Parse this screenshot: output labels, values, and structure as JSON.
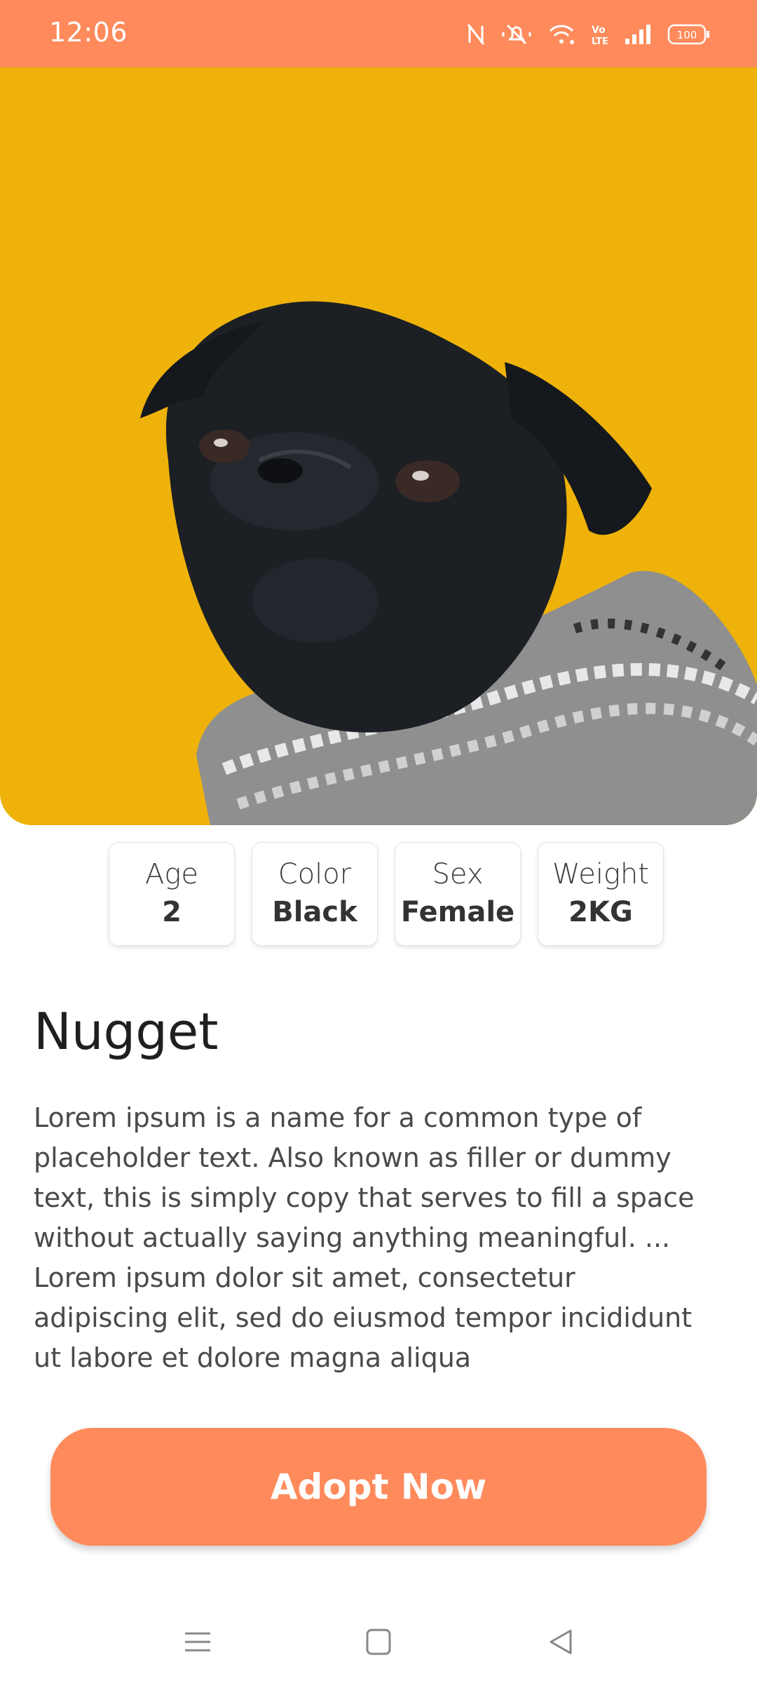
{
  "status_bar": {
    "time": "12:06",
    "battery": "100",
    "icons": [
      "nfc-icon",
      "mute-icon",
      "wifi-icon",
      "volte-icon",
      "signal-icon",
      "battery-icon"
    ]
  },
  "hero": {
    "image": "black-pug-in-sweater-photo",
    "background": "#EEB20A"
  },
  "stats": [
    {
      "label": "Age",
      "value": "2"
    },
    {
      "label": "Color",
      "value": "Black"
    },
    {
      "label": "Sex",
      "value": "Female"
    },
    {
      "label": "Weight",
      "value": "2KG"
    }
  ],
  "pet": {
    "name": "Nugget",
    "description": "Lorem ipsum is a name for a common type of placeholder text. Also known as filler or dummy text, this is simply copy that serves to fill a space without actually saying anything meaningful. ... Lorem ipsum dolor sit amet, consectetur adipiscing elit, sed do eiusmod tempor incididunt ut labore et dolore magna aliqua"
  },
  "actions": {
    "adopt_label": "Adopt Now"
  },
  "nav": {
    "buttons": [
      "menu-icon",
      "home-icon",
      "back-icon"
    ]
  },
  "colors": {
    "accent": "#FF8A5B",
    "hero_bg": "#EEB20A"
  }
}
